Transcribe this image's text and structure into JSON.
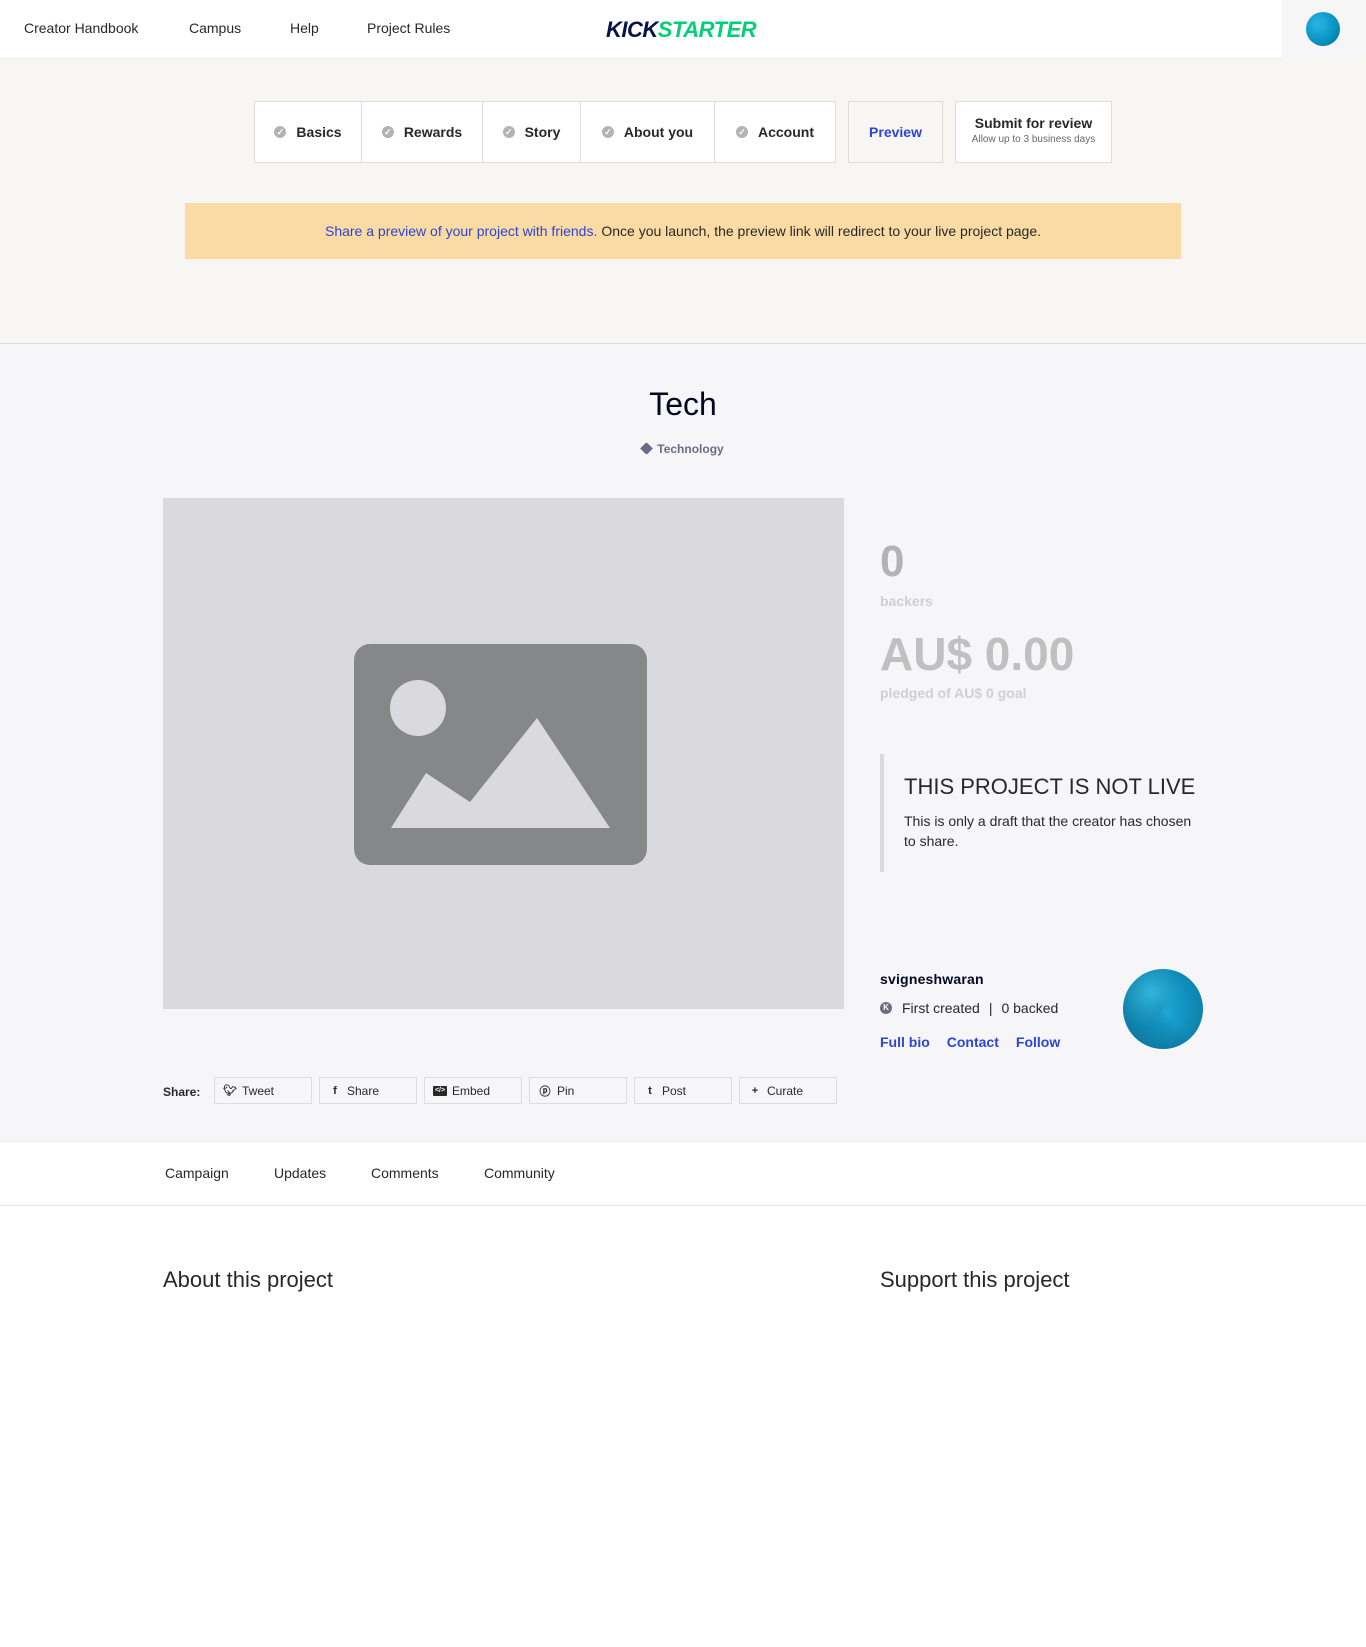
{
  "nav": {
    "links": [
      "Creator Handbook",
      "Campus",
      "Help",
      "Project Rules"
    ],
    "logo_kick": "KICK",
    "logo_starter": "STARTER"
  },
  "steps": [
    {
      "label": "Basics",
      "icon": "check-circle-icon"
    },
    {
      "label": "Rewards",
      "icon": "check-circle-icon"
    },
    {
      "label": "Story",
      "icon": "check-circle-icon"
    },
    {
      "label": "About you",
      "icon": "check-circle-icon"
    },
    {
      "label": "Account",
      "icon": "check-circle-icon"
    }
  ],
  "preview_label": "Preview",
  "submit": {
    "label": "Submit for review",
    "sublabel": "Allow up to 3 business days"
  },
  "banner": {
    "link_text": "Share a preview of your project with friends.",
    "text": "Once you launch, the preview link will redirect to your live project page."
  },
  "project": {
    "title": "Tech",
    "category": "Technology",
    "backers_count": "0",
    "backers_label": "backers",
    "pledged": "AU$ 0.00",
    "pledged_label": "pledged of AU$ 0 goal",
    "notice_title": "THIS PROJECT IS NOT LIVE",
    "notice_text": "This is only a draft that the creator has chosen to share."
  },
  "creator": {
    "name": "svigneshwaran",
    "first_created": "First created",
    "backed": "0 backed",
    "separator": "|",
    "links": [
      "Full bio",
      "Contact",
      "Follow"
    ]
  },
  "share": {
    "label": "Share:",
    "buttons": [
      {
        "label": "Tweet",
        "icon": "twitter-icon"
      },
      {
        "label": "Share",
        "icon": "facebook-icon"
      },
      {
        "label": "Embed",
        "icon": "embed-icon"
      },
      {
        "label": "Pin",
        "icon": "pinterest-icon"
      },
      {
        "label": "Post",
        "icon": "tumblr-icon"
      },
      {
        "label": "Curate",
        "icon": "plus-icon"
      }
    ]
  },
  "tabs": [
    "Campaign",
    "Updates",
    "Comments",
    "Community"
  ],
  "sections": {
    "about": "About this project",
    "support": "Support this project"
  },
  "colors": {
    "brand_dark": "#081245",
    "brand_green": "#05ce78",
    "link_blue": "#2e44d6",
    "banner_bg": "#fadba4"
  }
}
